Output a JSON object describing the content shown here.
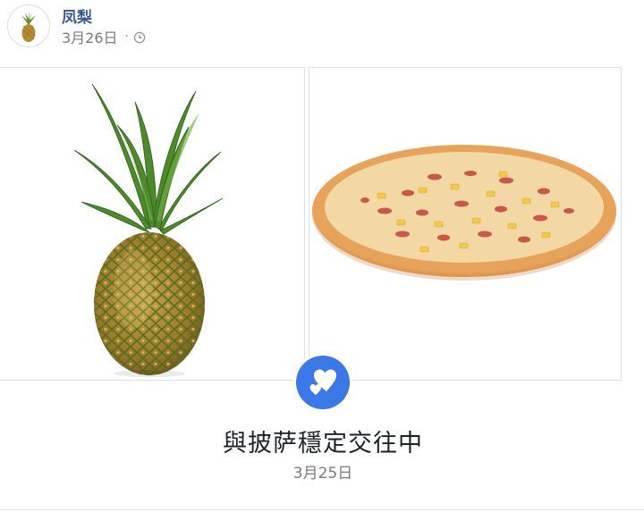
{
  "post": {
    "author": "凤梨",
    "date": "3月26日",
    "separator": "·",
    "privacy_icon": "clock-icon"
  },
  "life_event": {
    "icon": "hearts-icon",
    "accent": "#3b78e7",
    "text": "與披萨穩定交往中",
    "date": "3月25日"
  },
  "photos": [
    {
      "subject": "pineapple"
    },
    {
      "subject": "pizza"
    }
  ],
  "colors": {
    "author": "#385898",
    "meta": "#777c85",
    "status_text": "#1d2129",
    "border": "#dddfe2"
  }
}
